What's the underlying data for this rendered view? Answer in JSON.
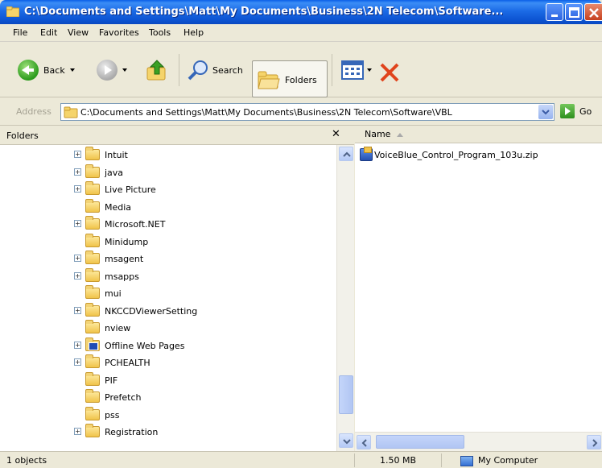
{
  "window": {
    "title": "C:\\Documents and Settings\\Matt\\My Documents\\Business\\2N Telecom\\Software..."
  },
  "menu": {
    "items": [
      "File",
      "Edit",
      "View",
      "Favorites",
      "Tools",
      "Help"
    ]
  },
  "toolbar": {
    "back_label": "Back",
    "search_label": "Search",
    "folders_label": "Folders"
  },
  "address": {
    "label": "Address",
    "path": "C:\\Documents and Settings\\Matt\\My Documents\\Business\\2N Telecom\\Software\\VBL",
    "go_label": "Go"
  },
  "folders_pane": {
    "header": "Folders",
    "items": [
      {
        "label": "Intuit",
        "expandable": true,
        "icon": "folder"
      },
      {
        "label": "java",
        "expandable": true,
        "icon": "folder"
      },
      {
        "label": "Live Picture",
        "expandable": true,
        "icon": "folder"
      },
      {
        "label": "Media",
        "expandable": false,
        "icon": "folder"
      },
      {
        "label": "Microsoft.NET",
        "expandable": true,
        "icon": "folder"
      },
      {
        "label": "Minidump",
        "expandable": false,
        "icon": "folder"
      },
      {
        "label": "msagent",
        "expandable": true,
        "icon": "folder"
      },
      {
        "label": "msapps",
        "expandable": true,
        "icon": "folder"
      },
      {
        "label": "mui",
        "expandable": false,
        "icon": "folder"
      },
      {
        "label": "NKCCDViewerSetting",
        "expandable": true,
        "icon": "folder"
      },
      {
        "label": "nview",
        "expandable": false,
        "icon": "folder"
      },
      {
        "label": "Offline Web Pages",
        "expandable": true,
        "icon": "web-folder"
      },
      {
        "label": "PCHEALTH",
        "expandable": true,
        "icon": "folder"
      },
      {
        "label": "PIF",
        "expandable": false,
        "icon": "folder"
      },
      {
        "label": "Prefetch",
        "expandable": false,
        "icon": "folder"
      },
      {
        "label": "pss",
        "expandable": false,
        "icon": "folder"
      },
      {
        "label": "Registration",
        "expandable": true,
        "icon": "folder"
      }
    ]
  },
  "file_list": {
    "column_name": "Name",
    "files": [
      {
        "name": "VoiceBlue_Control_Program_103u.zip",
        "icon": "zip-file"
      }
    ]
  },
  "status": {
    "objects": "1 objects",
    "size": "1.50 MB",
    "location": "My Computer"
  }
}
